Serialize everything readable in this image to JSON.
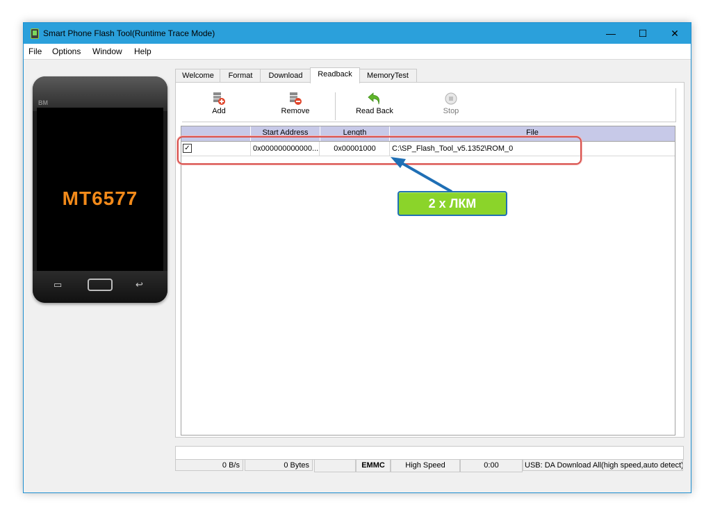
{
  "window": {
    "title": "Smart Phone Flash Tool(Runtime Trace Mode)",
    "controls": {
      "minimize": "—",
      "maximize": "☐",
      "close": "✕"
    }
  },
  "menu": [
    "File",
    "Options",
    "Window",
    "Help"
  ],
  "phone": {
    "brand": "BM",
    "model": "MT6577"
  },
  "tabs": [
    "Welcome",
    "Format",
    "Download",
    "Readback",
    "MemoryTest"
  ],
  "active_tab": "Readback",
  "toolbar": {
    "add": "Add",
    "remove": "Remove",
    "read_back": "Read Back",
    "stop": "Stop"
  },
  "table": {
    "headers": [
      "",
      "Start Address",
      "Length",
      "File"
    ],
    "rows": [
      {
        "checked": true,
        "start_address": "0x000000000000...",
        "length": "0x00001000",
        "file": "C:\\SP_Flash_Tool_v5.1352\\ROM_0"
      }
    ]
  },
  "statusbar": {
    "speed": "0 B/s",
    "bytes": "0 Bytes",
    "storage": "EMMC",
    "usb_speed": "High Speed",
    "time": "0:00",
    "usb_mode": "USB: DA Download All(high speed,auto detect)"
  },
  "annotation": {
    "callout": "2 x ЛКМ"
  },
  "colors": {
    "titlebar": "#2ba0db",
    "header": "#c7c9e8",
    "callout": "#8bd42a",
    "highlight": "#d9534f",
    "phone_model": "#f28a1a"
  }
}
